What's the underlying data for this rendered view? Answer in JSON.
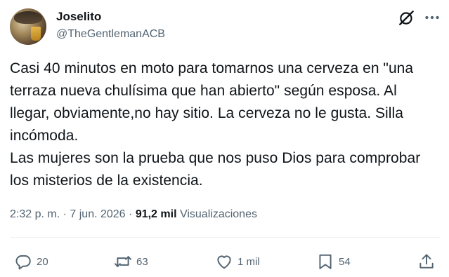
{
  "author": {
    "name": "Joselito",
    "handle": "@TheGentlemanACB"
  },
  "tweet": {
    "text": "Casi 40 minutos en moto para tomarnos una cerveza en \"una terraza nueva chulísima que han abierto\" según esposa. Al llegar, obviamente,no hay sitio. La cerveza no le gusta. Silla incómoda.\nLas mujeres son la prueba que nos puso Dios para comprobar los misterios de la existencia."
  },
  "meta": {
    "time": "2:32 p. m.",
    "separator": "·",
    "date": "7 jun. 2026",
    "views_count": "91,2 mil",
    "views_label": "Visualizaciones"
  },
  "actions": {
    "replies": "20",
    "retweets": "63",
    "likes": "1 mil",
    "bookmarks": "54"
  },
  "icons": [
    "grok-icon",
    "more-icon",
    "reply-icon",
    "retweet-icon",
    "like-icon",
    "bookmark-icon",
    "share-icon"
  ]
}
